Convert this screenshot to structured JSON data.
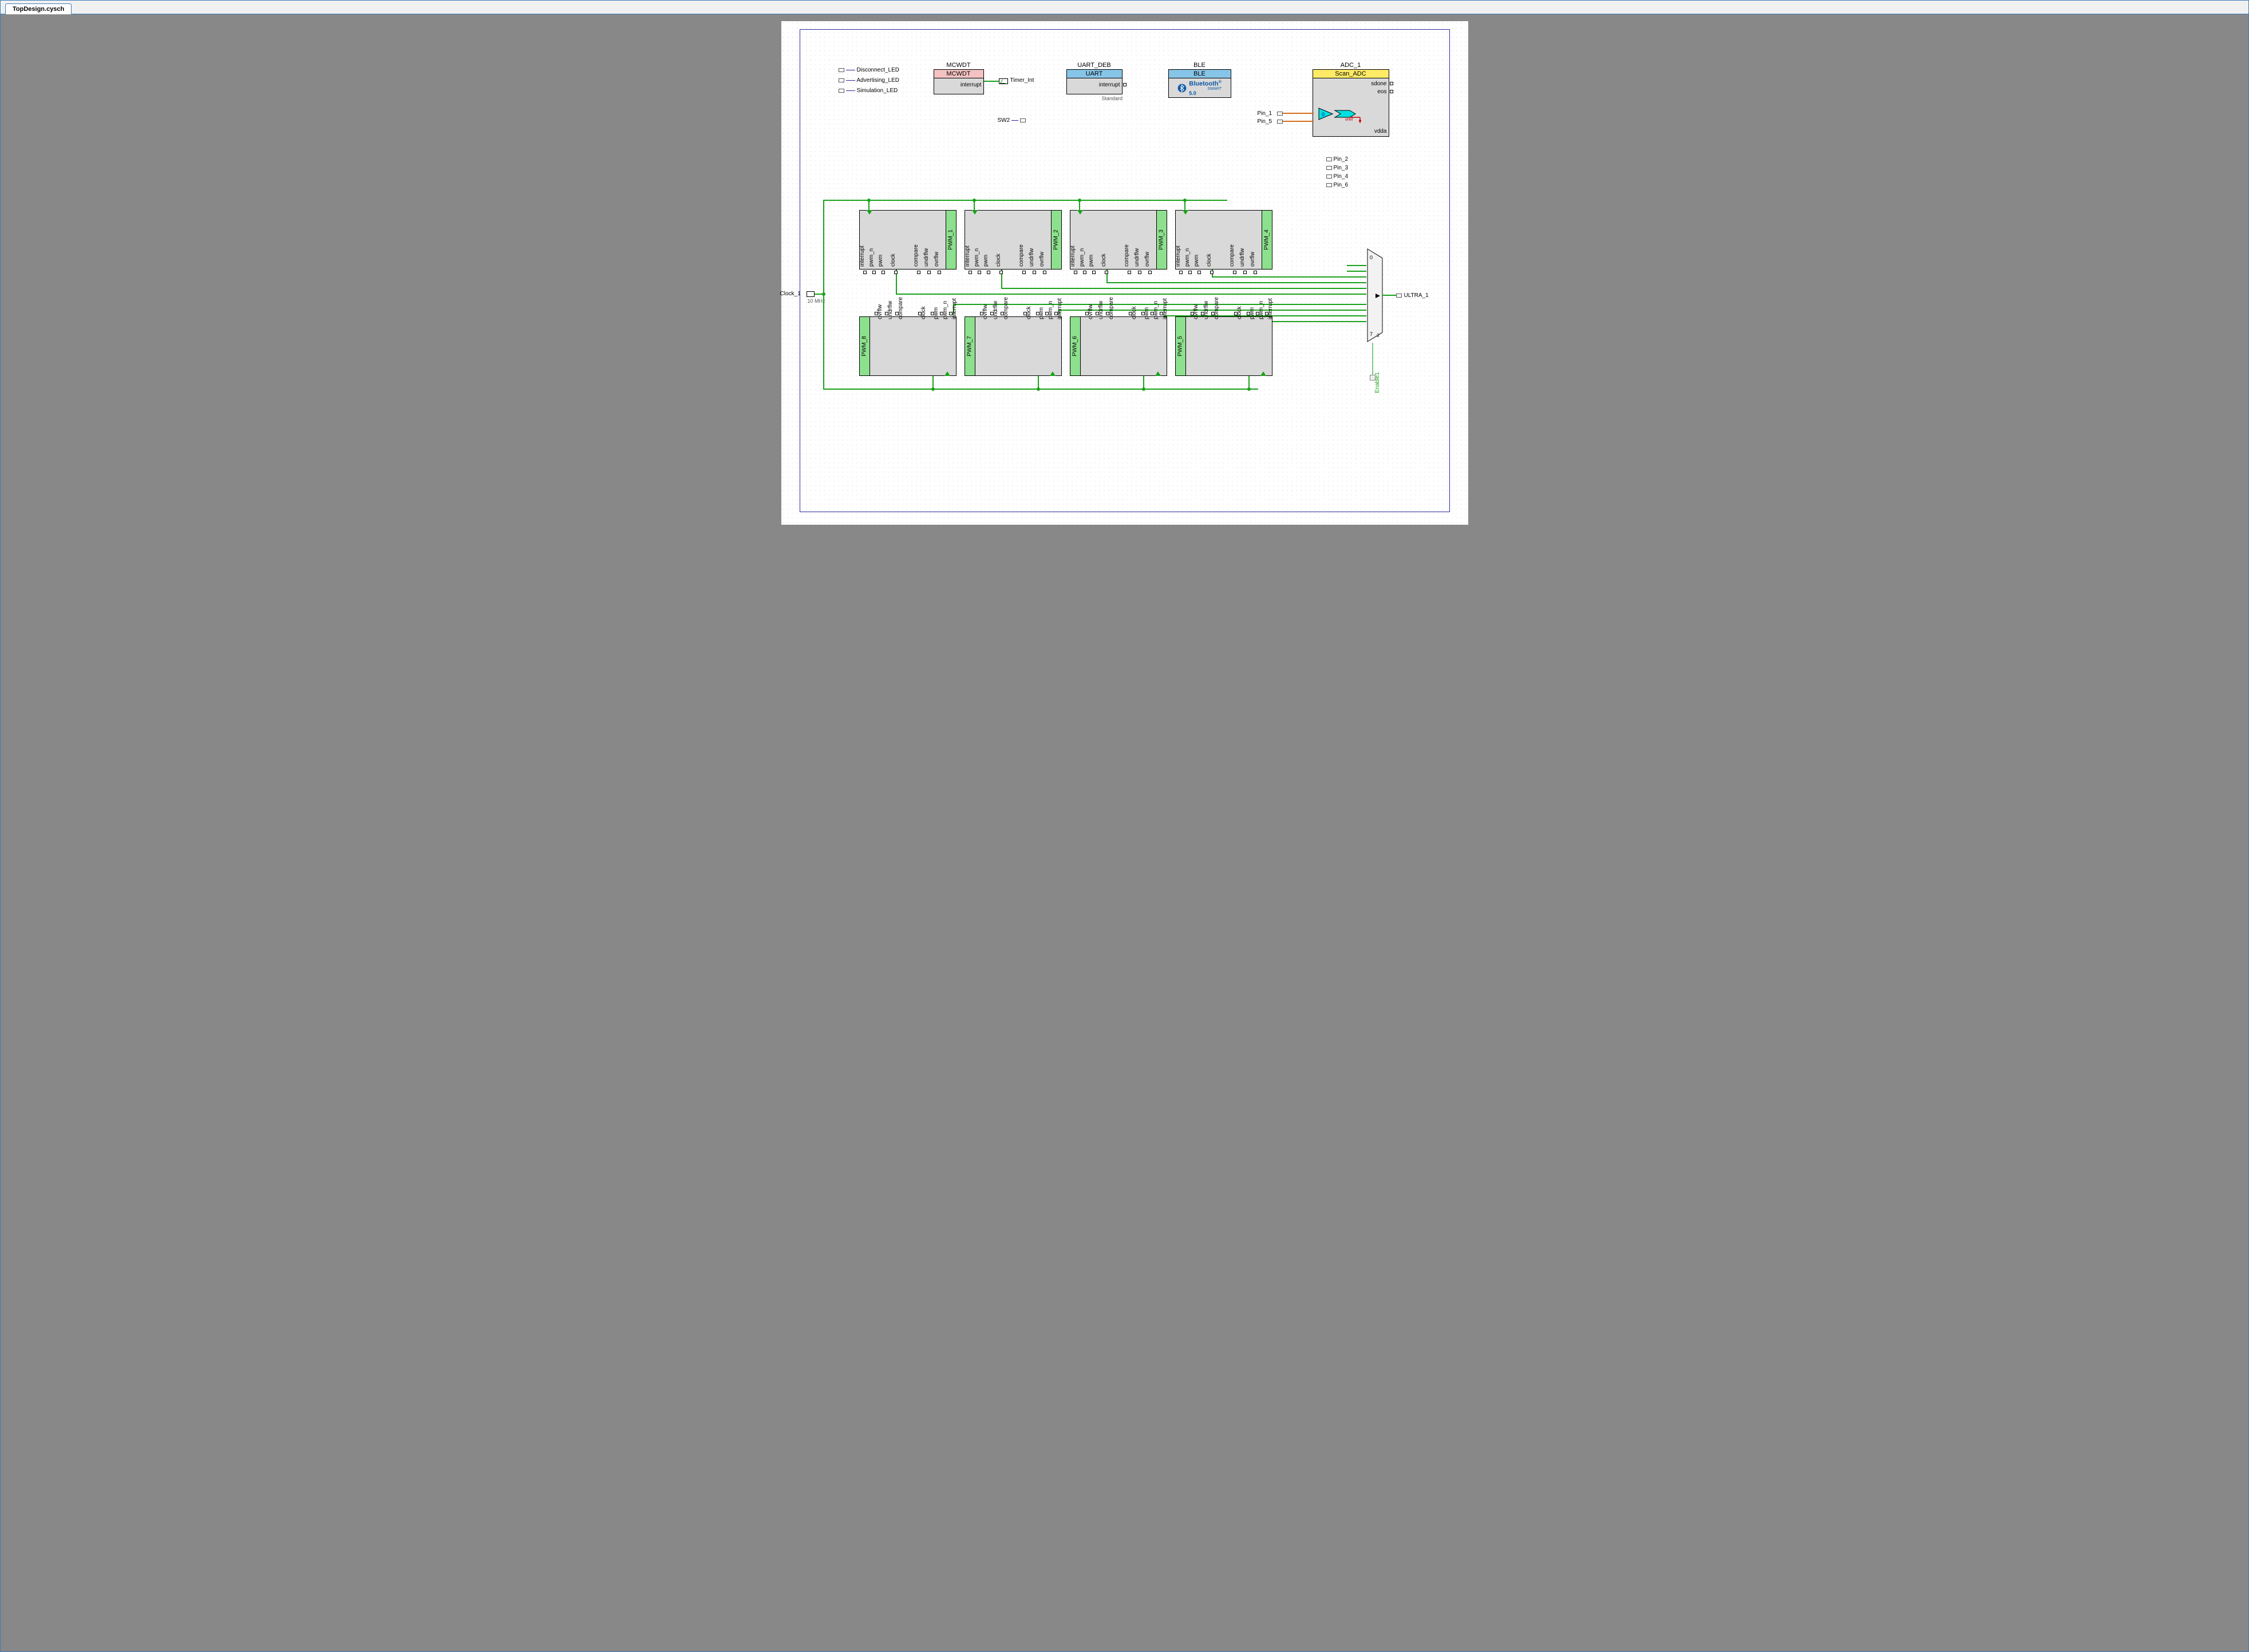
{
  "tab": {
    "label": "TopDesign.cysch"
  },
  "leds": {
    "disconnect": {
      "label": "Disconnect_LED"
    },
    "advertising": {
      "label": "Advertising_LED"
    },
    "simulation": {
      "label": "Simulation_LED"
    }
  },
  "sw2": {
    "label": "SW2"
  },
  "mcwdt": {
    "title": "MCWDT",
    "header": "MCWDT",
    "port_interrupt": "interrupt",
    "isr_label": "Timer_Int"
  },
  "uart": {
    "title": "UART_DEB",
    "header": "UART",
    "port_interrupt": "interrupt",
    "footnote": "Standard"
  },
  "ble": {
    "title": "BLE",
    "header": "BLE",
    "brand": "Bluetooth",
    "brand_sub": "SMART",
    "version": "5.0"
  },
  "adc": {
    "title": "ADC_1",
    "header": "Scan_ADC",
    "port_sdone": "sdone",
    "port_eos": "eos",
    "port_vref": "vref",
    "port_vdda": "vdda",
    "ch": "0",
    "pin1": "Pin_1",
    "pin5": "Pin_5"
  },
  "free_pins": [
    "Pin_2",
    "Pin_3",
    "Pin_4",
    "Pin_6"
  ],
  "clock": {
    "label": "Clock_1",
    "freq": "10 MHz"
  },
  "mux": {
    "out_pin_label": "ULTRA_1",
    "ch_top": "0",
    "ch_bot": "7",
    "sel": "3",
    "enable_label": "Enable1"
  },
  "pwm": {
    "ports": [
      "interrupt",
      "pwm_n",
      "pwm",
      "clock",
      "compare",
      "undrflw",
      "ovrflw"
    ],
    "top": [
      {
        "side": "PWM_1"
      },
      {
        "side": "PWM_2"
      },
      {
        "side": "PWM_3"
      },
      {
        "side": "PWM_4"
      }
    ],
    "bottom": [
      {
        "side": "PWM_8"
      },
      {
        "side": "PWM_7"
      },
      {
        "side": "PWM_6"
      },
      {
        "side": "PWM_5"
      }
    ]
  }
}
